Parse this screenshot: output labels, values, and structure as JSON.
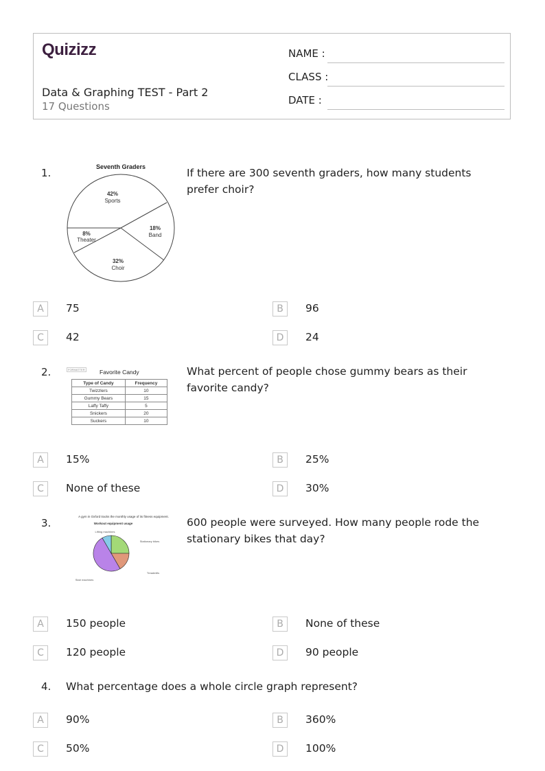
{
  "header": {
    "logo": "Quizizz",
    "title": "Data & Graphing TEST - Part 2",
    "subtitle": "17 Questions",
    "fields": [
      {
        "label": "NAME :"
      },
      {
        "label": "CLASS :"
      },
      {
        "label": "DATE  :"
      }
    ]
  },
  "questions": [
    {
      "number": "1.",
      "text": "If there are 300 seventh graders, how many students prefer choir?",
      "options": [
        {
          "letter": "A",
          "value": "75"
        },
        {
          "letter": "B",
          "value": "96"
        },
        {
          "letter": "C",
          "value": "42"
        },
        {
          "letter": "D",
          "value": "24"
        }
      ],
      "figure": {
        "title": "Seventh Graders",
        "slices": [
          {
            "label": "Sports",
            "pct": "42%"
          },
          {
            "label": "Band",
            "pct": "18%"
          },
          {
            "label": "Choir",
            "pct": "32%"
          },
          {
            "label": "Theater",
            "pct": "8%"
          }
        ]
      }
    },
    {
      "number": "2.",
      "text": "What percent of people chose gummy bears as their favorite candy?",
      "options": [
        {
          "letter": "A",
          "value": "15%"
        },
        {
          "letter": "B",
          "value": "25%"
        },
        {
          "letter": "C",
          "value": "None of these"
        },
        {
          "letter": "D",
          "value": "30%"
        }
      ],
      "figure": {
        "tag": "FORMATTER",
        "title": "Favorite Candy",
        "headers": [
          "Type of Candy",
          "Frequency"
        ],
        "rows": [
          [
            "Twizzlers",
            "10"
          ],
          [
            "Gummy Bears",
            "15"
          ],
          [
            "Laffy Taffy",
            "5"
          ],
          [
            "Snickers",
            "20"
          ],
          [
            "Suckers",
            "10"
          ]
        ]
      }
    },
    {
      "number": "3.",
      "text": "600 people were surveyed. How many people rode the stationary bikes that day?",
      "options": [
        {
          "letter": "A",
          "value": "150 people"
        },
        {
          "letter": "B",
          "value": "None of these"
        },
        {
          "letter": "C",
          "value": "120 people"
        },
        {
          "letter": "D",
          "value": "90 people"
        }
      ],
      "figure": {
        "caption": "A gym in Oxford tracks the monthly usage of its fitness equipment.",
        "title": "Workout equipment usage",
        "slices": [
          {
            "label": "Stationary bikes",
            "fraction": "1/4",
            "color": "#a3d977"
          },
          {
            "label": "Treadmills",
            "fraction": "1/6",
            "color": "#e0987a"
          },
          {
            "label": "Stair machines",
            "fraction": "1/2",
            "color": "#b983e8"
          },
          {
            "label": "Lifting machines",
            "fraction": "1/12",
            "color": "#87cbe8"
          }
        ]
      }
    },
    {
      "number": "4.",
      "text": "What percentage does a whole circle graph represent?",
      "options": [
        {
          "letter": "A",
          "value": "90%"
        },
        {
          "letter": "B",
          "value": "360%"
        },
        {
          "letter": "C",
          "value": "50%"
        },
        {
          "letter": "D",
          "value": "100%"
        }
      ]
    }
  ]
}
